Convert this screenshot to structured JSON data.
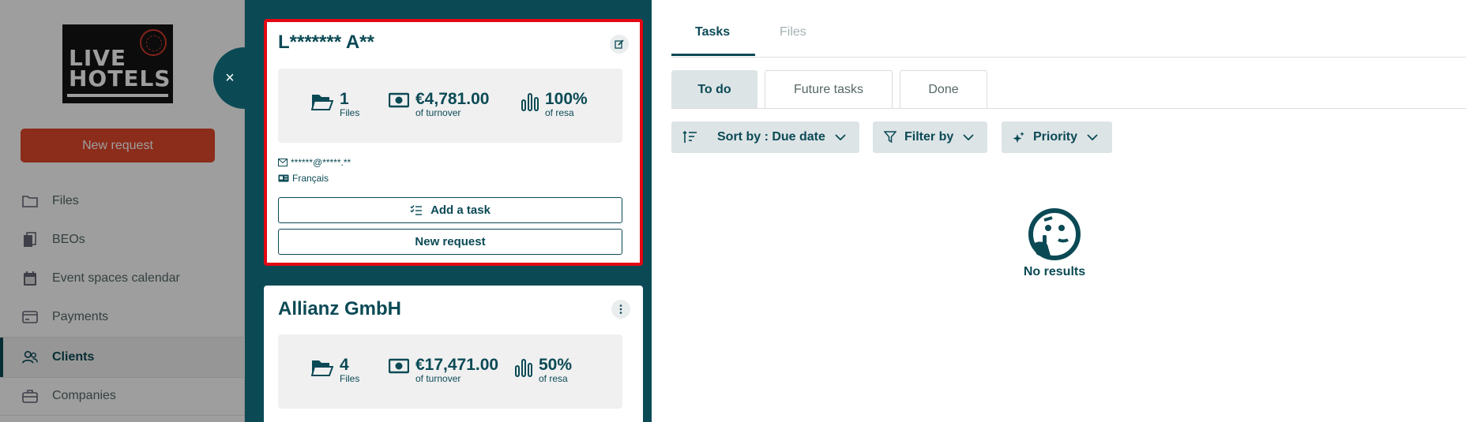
{
  "sidebar": {
    "logo_text": "LIVE HOTELS",
    "new_request_label": "New request",
    "nav": [
      {
        "label": "Files",
        "icon": "folder-icon"
      },
      {
        "label": "BEOs",
        "icon": "documents-icon"
      },
      {
        "label": "Event spaces calendar",
        "icon": "calendar-icon"
      },
      {
        "label": "Payments",
        "icon": "credit-card-icon"
      },
      {
        "label": "Clients",
        "icon": "users-icon",
        "active": true
      },
      {
        "label": "Companies",
        "icon": "briefcase-icon"
      }
    ]
  },
  "close_symbol": "×",
  "clients": [
    {
      "name": "L******* A**",
      "selected": true,
      "files_count": "1",
      "files_label": "Files",
      "turnover": "€4,781.00",
      "turnover_label": "of turnover",
      "resa_pct": "100%",
      "resa_label": "of resa",
      "email": "******@*****.**",
      "language": "Français",
      "add_task_label": "Add a task",
      "new_request_label": "New request"
    },
    {
      "name": "Allianz GmbH",
      "selected": false,
      "files_count": "4",
      "files_label": "Files",
      "turnover": "€17,471.00",
      "turnover_label": "of turnover",
      "resa_pct": "50%",
      "resa_label": "of resa"
    }
  ],
  "tasks": {
    "tabs": [
      "Tasks",
      "Files"
    ],
    "active_tab": "Tasks",
    "sub_tabs": [
      "To do",
      "Future tasks",
      "Done"
    ],
    "active_sub_tab": "To do",
    "sort_label": "Sort by : Due date",
    "filter_label": "Filter by",
    "priority_label": "Priority",
    "empty_text": "No results"
  },
  "colors": {
    "brand_teal": "#0b4a55",
    "accent_red": "#e2472b",
    "selection_red": "#e30613"
  }
}
